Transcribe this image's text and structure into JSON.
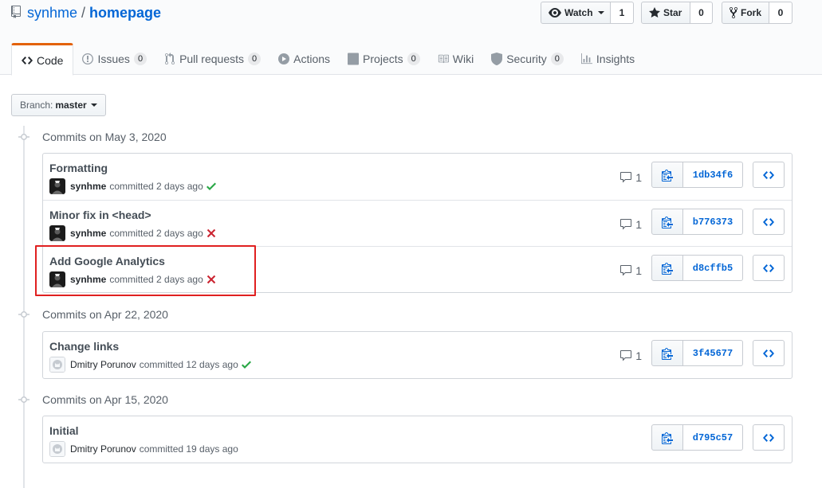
{
  "repo": {
    "owner": "synhme",
    "separator": "/",
    "name": "homepage"
  },
  "actions": {
    "watch": {
      "label": "Watch",
      "count": "1"
    },
    "star": {
      "label": "Star",
      "count": "0"
    },
    "fork": {
      "label": "Fork",
      "count": "0"
    }
  },
  "tabs": [
    {
      "label": "Code",
      "icon": "code-icon",
      "selected": true
    },
    {
      "label": "Issues",
      "counter": "0",
      "icon": "issue-icon"
    },
    {
      "label": "Pull requests",
      "counter": "0",
      "icon": "pull-request-icon"
    },
    {
      "label": "Actions",
      "icon": "play-icon"
    },
    {
      "label": "Projects",
      "counter": "0",
      "icon": "project-icon"
    },
    {
      "label": "Wiki",
      "icon": "book-icon"
    },
    {
      "label": "Security",
      "counter": "0",
      "icon": "shield-icon"
    },
    {
      "label": "Insights",
      "icon": "graph-icon"
    }
  ],
  "branch": {
    "prefix": "Branch:",
    "name": "master"
  },
  "groups": [
    {
      "date": "Commits on May 3, 2020",
      "commits": [
        {
          "title": "Formatting",
          "author": "synhme",
          "committed": "committed 2 days ago",
          "status": "success",
          "comments": "1",
          "sha": "1db34f6"
        },
        {
          "title": "Minor fix in <head>",
          "author": "synhme",
          "committed": "committed 2 days ago",
          "status": "failure",
          "comments": "1",
          "sha": "b776373"
        },
        {
          "title": "Add Google Analytics",
          "author": "synhme",
          "committed": "committed 2 days ago",
          "status": "failure",
          "comments": "1",
          "sha": "d8cffb5"
        }
      ]
    },
    {
      "date": "Commits on Apr 22, 2020",
      "commits": [
        {
          "title": "Change links",
          "author": "Dmitry Porunov",
          "committed": "committed 12 days ago",
          "status": "success",
          "comments": "1",
          "sha": "3f45677"
        }
      ]
    },
    {
      "date": "Commits on Apr 15, 2020",
      "commits": [
        {
          "title": "Initial",
          "author": "Dmitry Porunov",
          "committed": "committed 19 days ago",
          "status": "none",
          "comments": "",
          "sha": "d795c57"
        }
      ]
    }
  ],
  "colors": {
    "link": "#0366d6",
    "success": "#28a745",
    "failure": "#cb2431",
    "tab_accent": "#e36209",
    "highlight": "#e02020"
  }
}
